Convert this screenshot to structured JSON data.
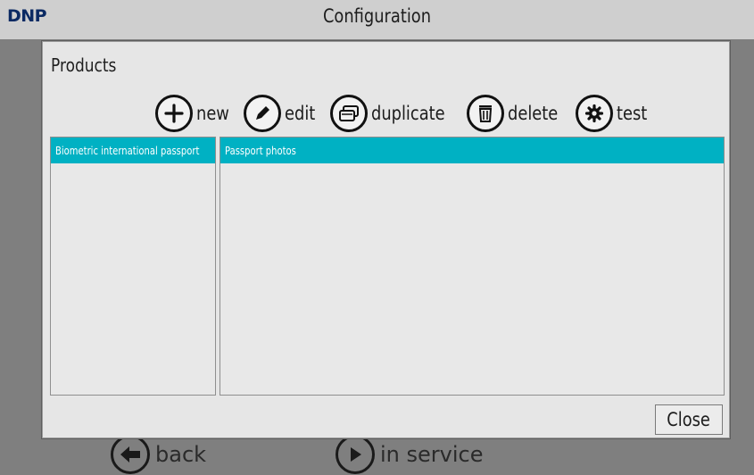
{
  "app": {
    "logo": "DNP",
    "title": "Configuration"
  },
  "bottom_bar": {
    "back_label": "back",
    "in_service_label": "in service"
  },
  "dialog": {
    "title": "Products",
    "toolbar": [
      {
        "label": "new",
        "icon": "plus-icon"
      },
      {
        "label": "edit",
        "icon": "pencil-icon"
      },
      {
        "label": "duplicate",
        "icon": "duplicate-icon"
      },
      {
        "label": "delete",
        "icon": "trash-icon"
      },
      {
        "label": "test",
        "icon": "gear-icon"
      }
    ],
    "categories": [
      {
        "label": "Biometric international passport",
        "selected": true
      }
    ],
    "products": [
      {
        "label": "Passport photos",
        "selected": true
      }
    ],
    "close_label": "Close"
  },
  "colors": {
    "selection": "#00b1c3",
    "dialog_bg": "#e6e6e6",
    "overlay": "#7f7f7f"
  }
}
